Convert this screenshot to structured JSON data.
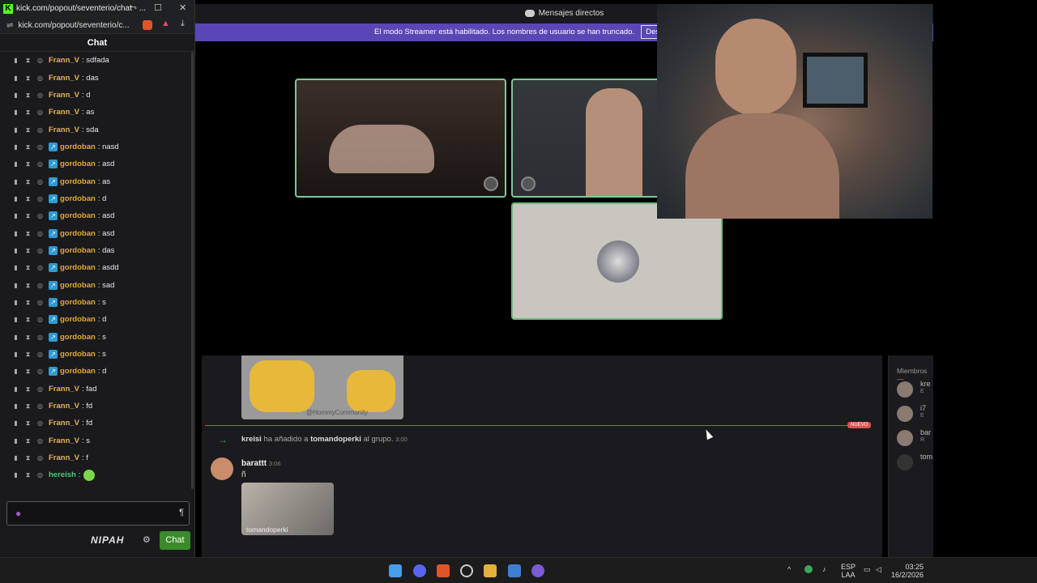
{
  "kick": {
    "window_title": "kick.com/popout/seventerio/chat - ...",
    "url": "kick.com/popout/seventerio/c...",
    "header": "Chat",
    "messages": [
      {
        "user": "Frann_V",
        "text": ": sdfada",
        "badge": false,
        "color": "#e6b35a"
      },
      {
        "user": "Frann_V",
        "text": ": das",
        "badge": false,
        "color": "#e6b35a"
      },
      {
        "user": "Frann_V",
        "text": ": d",
        "badge": false,
        "color": "#e6b35a"
      },
      {
        "user": "Frann_V",
        "text": ": as",
        "badge": false,
        "color": "#e6b35a"
      },
      {
        "user": "Frann_V",
        "text": ": sda",
        "badge": false,
        "color": "#e6b35a"
      },
      {
        "user": "gordoban",
        "text": ": nasd",
        "badge": true,
        "color": "#e0a83a"
      },
      {
        "user": "gordoban",
        "text": ": asd",
        "badge": true,
        "color": "#e0a83a"
      },
      {
        "user": "gordoban",
        "text": ": as",
        "badge": true,
        "color": "#e0a83a"
      },
      {
        "user": "gordoban",
        "text": ": d",
        "badge": true,
        "color": "#e0a83a"
      },
      {
        "user": "gordoban",
        "text": ": asd",
        "badge": true,
        "color": "#e0a83a"
      },
      {
        "user": "gordoban",
        "text": ": asd",
        "badge": true,
        "color": "#e0a83a"
      },
      {
        "user": "gordoban",
        "text": ": das",
        "badge": true,
        "color": "#e0a83a"
      },
      {
        "user": "gordoban",
        "text": ": asdd",
        "badge": true,
        "color": "#e0a83a"
      },
      {
        "user": "gordoban",
        "text": ": sad",
        "badge": true,
        "color": "#e0a83a"
      },
      {
        "user": "gordoban",
        "text": ": s",
        "badge": true,
        "color": "#e0a83a"
      },
      {
        "user": "gordoban",
        "text": ": d",
        "badge": true,
        "color": "#e0a83a"
      },
      {
        "user": "gordoban",
        "text": ": s",
        "badge": true,
        "color": "#e0a83a"
      },
      {
        "user": "gordoban",
        "text": ": s",
        "badge": true,
        "color": "#e0a83a"
      },
      {
        "user": "gordoban",
        "text": ": d",
        "badge": true,
        "color": "#e0a83a"
      },
      {
        "user": "Frann_V",
        "text": ": fad",
        "badge": false,
        "color": "#e6b35a"
      },
      {
        "user": "Frann_V",
        "text": ": fd",
        "badge": false,
        "color": "#e6b35a"
      },
      {
        "user": "Frann_V",
        "text": ": fd",
        "badge": false,
        "color": "#e6b35a"
      },
      {
        "user": "Frann_V",
        "text": ": s",
        "badge": false,
        "color": "#e6b35a"
      },
      {
        "user": "Frann_V",
        "text": ": f",
        "badge": false,
        "color": "#e6b35a"
      },
      {
        "user": "hereish",
        "text": ":",
        "badge": false,
        "color": "#4ec97a"
      }
    ],
    "nipah": "NIPAH",
    "chat_button": "Chat"
  },
  "discord": {
    "title": "Mensajes directos",
    "streamer_notice": "El modo Streamer está habilitado. Los nombres de usuario se han truncado.",
    "streamer_button": "Deshabi",
    "new_badge": "NUEVO",
    "system_msg": {
      "actor": "kreisi",
      "action": " ha añadido a ",
      "target": "tomandoperki",
      "suffix": " al grupo.",
      "time": "3:00"
    },
    "message": {
      "author": "barattt",
      "time": "3:06",
      "text": "ñ",
      "embed_label": "tomandoperki"
    },
    "sticker_watermark": "@HommyCommunity",
    "members_header": "Miembros—",
    "members": [
      {
        "name": "kre",
        "sub": "E"
      },
      {
        "name": "i7",
        "sub": "E"
      },
      {
        "name": "bar",
        "sub": "R"
      },
      {
        "name": "tom",
        "sub": ""
      }
    ]
  },
  "taskbar": {
    "lang1": "ESP",
    "lang2": "LAA",
    "time": "03:25",
    "date": "16/2/2026"
  }
}
